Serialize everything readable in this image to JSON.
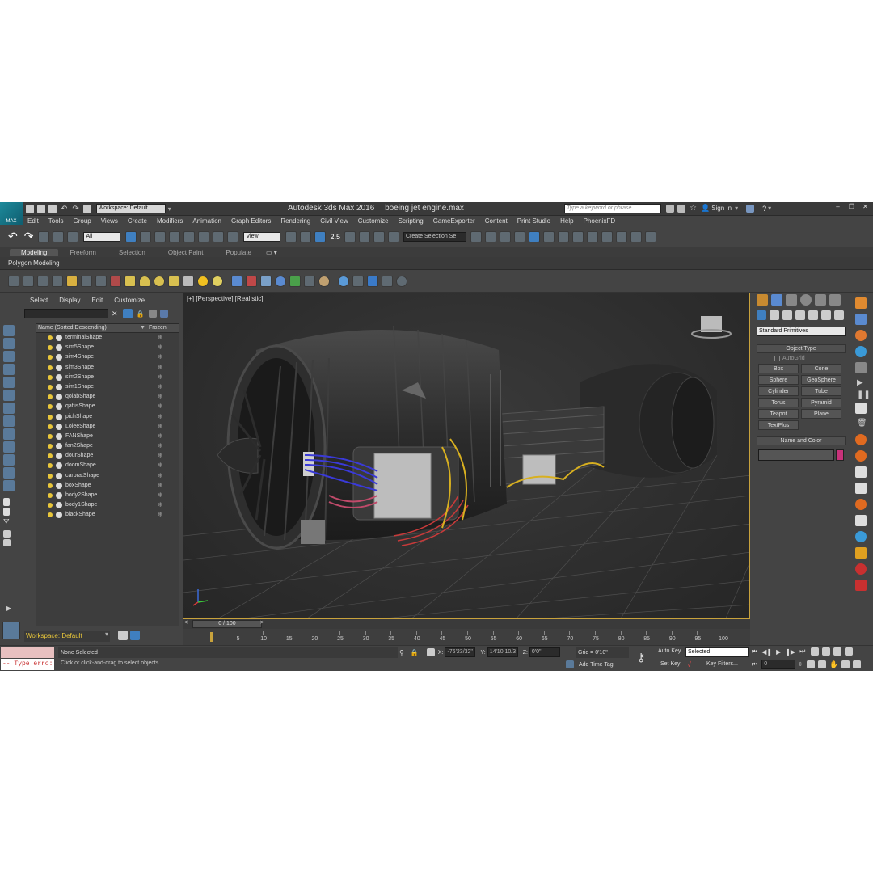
{
  "app": {
    "logo_text": "MAX",
    "title": "Autodesk 3ds Max 2016",
    "filename": "boeing jet engine.max",
    "workspace": "Workspace: Default",
    "search_placeholder": "Type a keyword or phrase",
    "sign_in": "Sign In"
  },
  "menu": [
    "Edit",
    "Tools",
    "Group",
    "Views",
    "Create",
    "Modifiers",
    "Animation",
    "Graph Editors",
    "Rendering",
    "Civil View",
    "Customize",
    "Scripting",
    "GameExporter",
    "Content",
    "Print Studio",
    "Help",
    "PhoenixFD"
  ],
  "main_toolbar": {
    "filter_select": "All",
    "coord_select": "View",
    "snap_value": "2.5",
    "selection_set_placeholder": "Create Selection Se"
  },
  "ribbon": {
    "tabs": [
      "Modeling",
      "Freeform",
      "Selection",
      "Object Paint",
      "Populate"
    ],
    "active_tab": "Modeling",
    "panel_label": "Polygon Modeling"
  },
  "scene_explorer": {
    "tabs": [
      "Select",
      "Display",
      "Edit",
      "Customize"
    ],
    "columns": [
      "Name (Sorted Descending)",
      "Frozen"
    ],
    "frozen_glyph": "❄",
    "items": [
      "terminalShape",
      "sim5Shape",
      "sim4Shape",
      "sim3Shape",
      "sim2Shape",
      "sim1Shape",
      "qolabShape",
      "qafiisShape",
      "pichShape",
      "LoleeShape",
      "FANShape",
      "fan2Shape",
      "dourShape",
      "doomShape",
      "carbratShape",
      "boxShape",
      "body2Shape",
      "body1Shape",
      "blackShape"
    ]
  },
  "viewport": {
    "label": "[+] [Perspective] [Realistic]"
  },
  "command_panel": {
    "category_select": "Standard Primitives",
    "object_type_header": "Object Type",
    "autogrid_label": "AutoGrid",
    "primitives": [
      "Box",
      "Cone",
      "Sphere",
      "GeoSphere",
      "Cylinder",
      "Tube",
      "Torus",
      "Pyramid",
      "Teapot",
      "Plane",
      "TextPlus"
    ],
    "name_color_header": "Name and Color",
    "swatch_color": "#c8327a"
  },
  "timeline": {
    "position": "0 / 100",
    "ticks": [
      "5",
      "10",
      "15",
      "20",
      "25",
      "30",
      "35",
      "40",
      "45",
      "50",
      "55",
      "60",
      "65",
      "70",
      "75",
      "80",
      "85",
      "90",
      "95",
      "100"
    ]
  },
  "status": {
    "workspace": "Workspace: Default",
    "script_text": "-- Type erro:",
    "selection": "None Selected",
    "prompt": "Click or click-and-drag to select objects",
    "x_label": "X:",
    "x_value": "-76'23/32\"",
    "y_label": "Y:",
    "y_value": "14'10 10/3",
    "z_label": "Z:",
    "z_value": "0'0\"",
    "grid": "Grid = 0'10\"",
    "add_time_tag": "Add Time Tag",
    "auto_key": "Auto Key",
    "auto_key_select": "Selected",
    "set_key": "Set Key",
    "key_filters": "Key Filters...",
    "frame": "0"
  }
}
